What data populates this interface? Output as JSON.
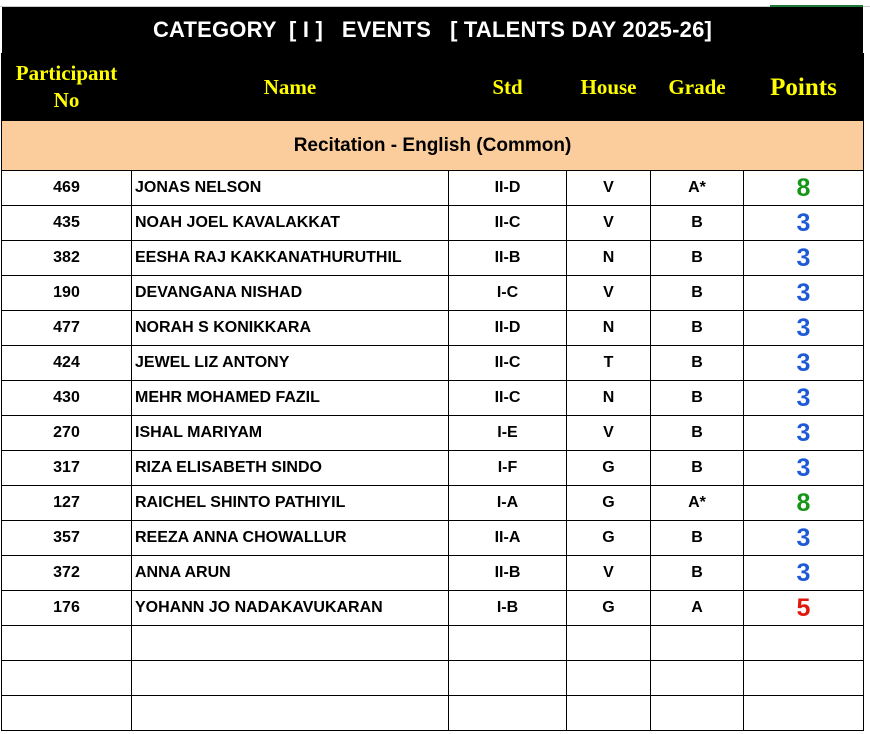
{
  "title": "CATEGORY  [ I ]   EVENTS   [ TALENTS DAY 2025-26]",
  "headers": {
    "participant_no": "Participant No",
    "name": "Name",
    "std": "Std",
    "house": "House",
    "grade": "Grade",
    "points": "Points"
  },
  "event": "Recitation - English (Common)",
  "colors": {
    "points_8": "#169619",
    "points_3": "#1f5ad6",
    "points_5": "#e0190f",
    "header_text": "#ffff00",
    "event_band": "#fbcc9c"
  },
  "rows": [
    {
      "no": "469",
      "name": "JONAS NELSON",
      "std": "II-D",
      "house": "V",
      "grade": "A*",
      "points": "8"
    },
    {
      "no": "435",
      "name": "NOAH JOEL KAVALAKKAT",
      "std": "II-C",
      "house": "V",
      "grade": "B",
      "points": "3"
    },
    {
      "no": "382",
      "name": "EESHA RAJ KAKKANATHURUTHIL",
      "std": "II-B",
      "house": "N",
      "grade": "B",
      "points": "3"
    },
    {
      "no": "190",
      "name": "DEVANGANA NISHAD",
      "std": "I-C",
      "house": "V",
      "grade": "B",
      "points": "3"
    },
    {
      "no": "477",
      "name": "NORAH S KONIKKARA",
      "std": "II-D",
      "house": "N",
      "grade": "B",
      "points": "3"
    },
    {
      "no": "424",
      "name": "JEWEL LIZ ANTONY",
      "std": "II-C",
      "house": "T",
      "grade": "B",
      "points": "3"
    },
    {
      "no": "430",
      "name": "MEHR MOHAMED FAZIL",
      "std": "II-C",
      "house": "N",
      "grade": "B",
      "points": "3"
    },
    {
      "no": "270",
      "name": "ISHAL MARIYAM",
      "std": "I-E",
      "house": "V",
      "grade": "B",
      "points": "3"
    },
    {
      "no": "317",
      "name": "RIZA ELISABETH SINDO",
      "std": "I-F",
      "house": "G",
      "grade": "B",
      "points": "3"
    },
    {
      "no": "127",
      "name": "RAICHEL SHINTO PATHIYIL",
      "std": "I-A",
      "house": "G",
      "grade": "A*",
      "points": "8"
    },
    {
      "no": "357",
      "name": "REEZA ANNA CHOWALLUR",
      "std": "II-A",
      "house": "G",
      "grade": "B",
      "points": "3"
    },
    {
      "no": "372",
      "name": "ANNA ARUN",
      "std": "II-B",
      "house": "V",
      "grade": "B",
      "points": "3"
    },
    {
      "no": "176",
      "name": "YOHANN JO NADAKAVUKARAN",
      "std": "I-B",
      "house": "G",
      "grade": "A",
      "points": "5"
    }
  ]
}
